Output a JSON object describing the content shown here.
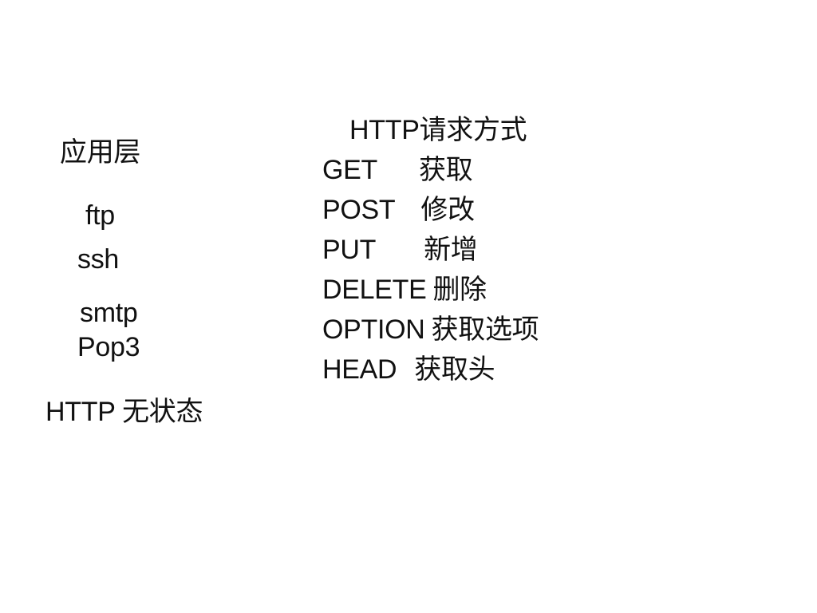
{
  "left": {
    "title": "应用层",
    "protocols": [
      "ftp",
      "ssh",
      "smtp",
      "Pop3"
    ],
    "note": "HTTP 无状态"
  },
  "right": {
    "title": "HTTP请求方式",
    "methods": [
      {
        "name": "GET",
        "desc": "获取"
      },
      {
        "name": "POST",
        "desc": "修改"
      },
      {
        "name": "PUT",
        "desc": "新增"
      },
      {
        "name": "DELETE",
        "desc": "删除"
      },
      {
        "name": "OPTION",
        "desc": "获取选项"
      },
      {
        "name": "HEAD",
        "desc": "获取头"
      }
    ]
  }
}
